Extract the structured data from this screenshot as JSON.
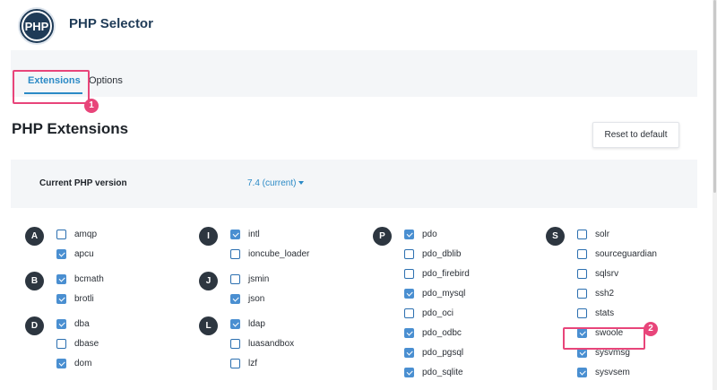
{
  "app": {
    "title": "PHP Selector",
    "logo_text": "PHP"
  },
  "tabs": [
    {
      "label": "Extensions",
      "active": true
    },
    {
      "label": "Options",
      "active": false
    }
  ],
  "annotations": {
    "badge1": "1",
    "badge2": "2",
    "color": "#e8457a"
  },
  "section": {
    "title": "PHP Extensions",
    "reset_label": "Reset to default"
  },
  "version": {
    "label": "Current PHP version",
    "value": "7.4 (current)"
  },
  "accent_color": "#2b8ac6",
  "groups": [
    {
      "letter": "A",
      "items": [
        {
          "name": "amqp",
          "checked": false
        },
        {
          "name": "apcu",
          "checked": true
        }
      ]
    },
    {
      "letter": "B",
      "items": [
        {
          "name": "bcmath",
          "checked": true
        },
        {
          "name": "brotli",
          "checked": true
        }
      ]
    },
    {
      "letter": "D",
      "items": [
        {
          "name": "dba",
          "checked": true
        },
        {
          "name": "dbase",
          "checked": false
        },
        {
          "name": "dom",
          "checked": true
        }
      ]
    },
    {
      "letter": "I",
      "items": [
        {
          "name": "intl",
          "checked": true
        },
        {
          "name": "ioncube_loader",
          "checked": false
        }
      ]
    },
    {
      "letter": "J",
      "items": [
        {
          "name": "jsmin",
          "checked": false
        },
        {
          "name": "json",
          "checked": true
        }
      ]
    },
    {
      "letter": "L",
      "items": [
        {
          "name": "ldap",
          "checked": true
        },
        {
          "name": "luasandbox",
          "checked": false
        },
        {
          "name": "lzf",
          "checked": false
        }
      ]
    },
    {
      "letter": "P",
      "items": [
        {
          "name": "pdo",
          "checked": true
        },
        {
          "name": "pdo_dblib",
          "checked": false
        },
        {
          "name": "pdo_firebird",
          "checked": false
        },
        {
          "name": "pdo_mysql",
          "checked": true
        },
        {
          "name": "pdo_oci",
          "checked": false
        },
        {
          "name": "pdo_odbc",
          "checked": true
        },
        {
          "name": "pdo_pgsql",
          "checked": true
        },
        {
          "name": "pdo_sqlite",
          "checked": true
        }
      ]
    },
    {
      "letter": "S",
      "items": [
        {
          "name": "solr",
          "checked": false
        },
        {
          "name": "sourceguardian",
          "checked": false
        },
        {
          "name": "sqlsrv",
          "checked": false
        },
        {
          "name": "ssh2",
          "checked": false
        },
        {
          "name": "stats",
          "checked": false
        },
        {
          "name": "swoole",
          "checked": true
        },
        {
          "name": "sysvmsg",
          "checked": true
        },
        {
          "name": "sysvsem",
          "checked": true
        }
      ]
    }
  ]
}
